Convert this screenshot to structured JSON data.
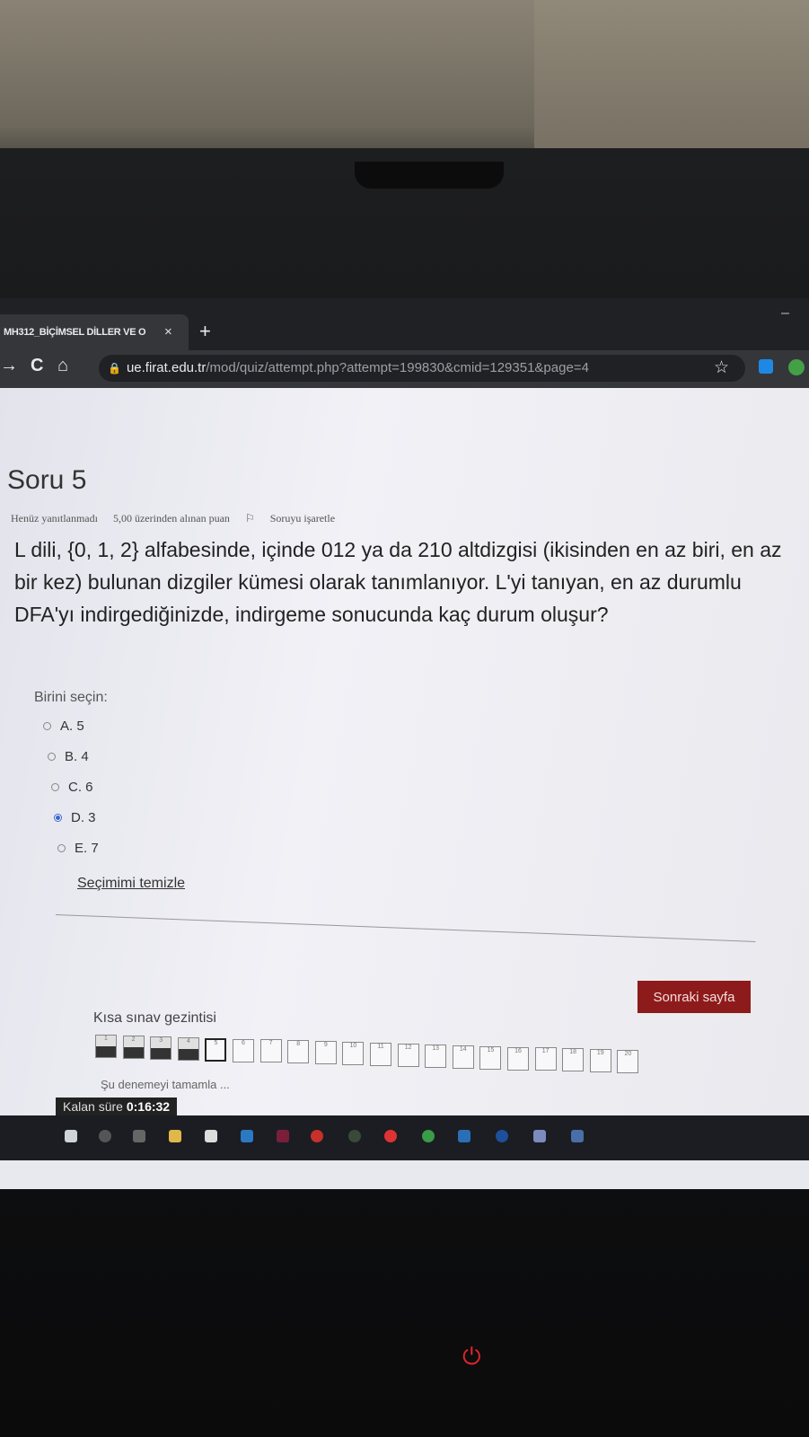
{
  "browser": {
    "tab_title": "MH312_BİÇİMSEL DİLLER VE O",
    "tab_close": "×",
    "new_tab": "+",
    "url_host": "ue.firat.edu.tr",
    "url_path": "/mod/quiz/attempt.php?attempt=199830&cmid=129351&page=4",
    "back_icon": "→",
    "reload_icon": "C",
    "home_icon": "⌂",
    "lock_icon": "🔒",
    "star_icon": "☆",
    "minimize": "–"
  },
  "question": {
    "title": "Soru 5",
    "status": "Henüz yanıtlanmadı",
    "points": "5,00 üzerinden alınan puan",
    "flag": "Soruyu işaretle",
    "text": "L dili, {0, 1, 2} alfabesinde, içinde 012 ya da 210 altdizgisi (ikisinden en az biri, en az bir kez) bulunan dizgiler kümesi olarak tanımlanıyor. L'yi tanıyan, en az durumlu DFA'yı indirgediğinizde, indirgeme sonucunda kaç durum oluşur?",
    "prompt": "Birini seçin:",
    "options": [
      {
        "label": "A. 5",
        "selected": false
      },
      {
        "label": "B. 4",
        "selected": false
      },
      {
        "label": "C. 6",
        "selected": false
      },
      {
        "label": "D. 3",
        "selected": true
      },
      {
        "label": "E. 7",
        "selected": false
      }
    ],
    "clear_choice": "Seçimimi temizle"
  },
  "quiz": {
    "next_button": "Sonraki sayfa",
    "nav_title": "Kısa sınav gezintisi",
    "nav_cells": [
      "1",
      "2",
      "3",
      "4",
      "5",
      "6",
      "7",
      "8",
      "9",
      "10",
      "11",
      "12",
      "13",
      "14",
      "15",
      "16",
      "17",
      "18",
      "19",
      "20"
    ],
    "answered": [
      1,
      2,
      3,
      4
    ],
    "current": 5,
    "finish_attempt": "Şu denemeyi tamamla ...",
    "timer_label": "Kalan süre",
    "timer_value": "0:16:32"
  },
  "colors": {
    "accent": "#8e1b1b",
    "link": "#3a65c8"
  }
}
